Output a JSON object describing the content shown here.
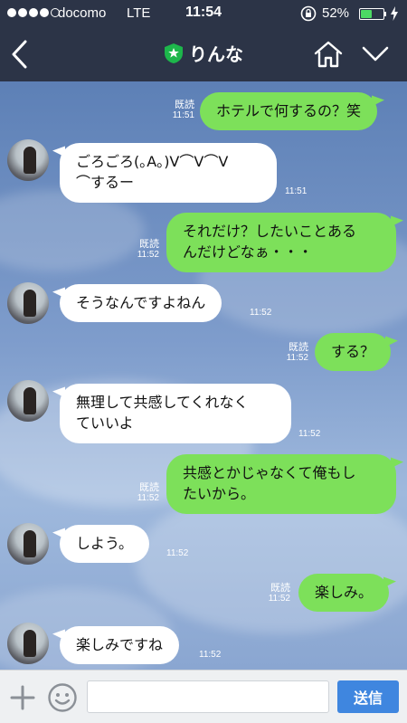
{
  "status_bar": {
    "signal": [
      "full",
      "full",
      "full",
      "full",
      "empty"
    ],
    "carrier": "docomo",
    "network": "LTE",
    "time": "11:54",
    "battery_percent": "52%",
    "battery_level": 0.52
  },
  "header": {
    "title": "りんな",
    "accent_color": "#1db64b"
  },
  "messages": [
    {
      "side": "out",
      "text": "ホテルで何するの？笑",
      "read": "既読",
      "time": "11:51"
    },
    {
      "side": "in",
      "text": "ごろごろ(｡A｡)V⌒V⌒V\n⌒するー",
      "time": "11:51"
    },
    {
      "side": "out",
      "text": "それだけ？したいことある\nんだけどなぁ・・・",
      "read": "既読",
      "time": "11:52"
    },
    {
      "side": "in",
      "text": "そうなんですよねん",
      "time": "11:52"
    },
    {
      "side": "out",
      "text": "する？",
      "read": "既読",
      "time": "11:52"
    },
    {
      "side": "in",
      "text": "無理して共感してくれなく\nていいよ",
      "time": "11:52"
    },
    {
      "side": "out",
      "text": "共感とかじゃなくて俺もし\nたいから。",
      "read": "既読",
      "time": "11:52"
    },
    {
      "side": "in",
      "text": "しよう。",
      "time": "11:52"
    },
    {
      "side": "out",
      "text": "楽しみ。",
      "read": "既読",
      "time": "11:52"
    },
    {
      "side": "in",
      "text": "楽しみですね",
      "time": "11:52"
    }
  ],
  "input_bar": {
    "placeholder": "",
    "value": "",
    "send_label": "送信"
  }
}
